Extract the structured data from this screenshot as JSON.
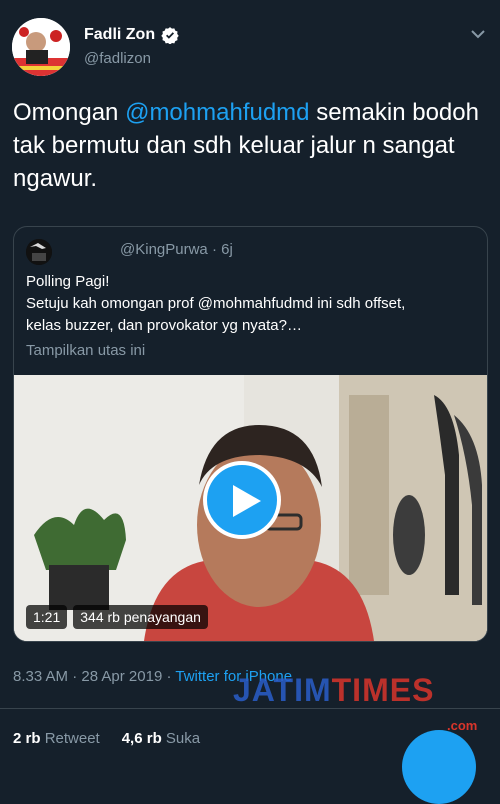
{
  "author": {
    "name": "Fadli Zon",
    "handle": "@fadlizon",
    "verified": true
  },
  "tweet": {
    "text_before": "Omongan ",
    "mention": "@mohmahfudmd",
    "text_after": " semakin bodoh tak bermutu dan sdh keluar jalur n sangat ngawur."
  },
  "quoted_tweet": {
    "handle": "@KingPurwa",
    "time": "· 6j",
    "line1": "Polling Pagi!",
    "line2": "Setuju kah omongan prof @mohmahfudmd ini sdh offset,",
    "line3": "kelas buzzer, dan provokator yg nyata?…",
    "show_thread": "Tampilkan utas ini",
    "video": {
      "duration": "1:21",
      "views": "344 rb penayangan"
    }
  },
  "meta": {
    "time": "8.33 AM",
    "separator1": " · ",
    "date": "28 Apr 2019",
    "separator2": " · ",
    "source": "Twitter for iPhone"
  },
  "stats": {
    "retweets_count": "2 rb",
    "retweets_label": "Retweet",
    "likes_count": "4,6 rb",
    "likes_label": "Suka"
  },
  "watermark": {
    "text_a": "JATIM",
    "text_b": "TIMES",
    "suffix": ".com"
  },
  "colors": {
    "background": "#15202b",
    "accent": "#1da1f2",
    "secondary_text": "#8899a6",
    "border": "#38444d"
  },
  "icons": [
    "verified-badge-icon",
    "chevron-down-icon",
    "play-icon",
    "compose-fab-icon"
  ]
}
